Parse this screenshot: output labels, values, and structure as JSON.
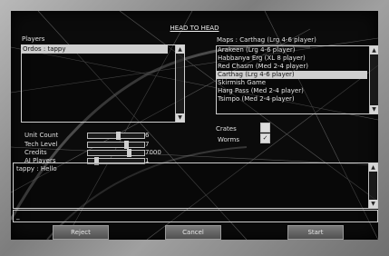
{
  "title": "HEAD TO HEAD",
  "players": {
    "label": "Players",
    "items": [
      "Ordos : tappy"
    ]
  },
  "maps": {
    "label": "Maps : Carthag (Lrg 4-6 player)",
    "items": [
      "Arakeen (Lrg 4-6 player)",
      "Habbanya Erg (XL 8 player)",
      "Red Chasm (Med 2-4 player)",
      "Carthag (Lrg 4-6 player)",
      "Skirmish Game",
      "Harg Pass (Med 2-4 player)",
      "Tsimpo (Med 2-4 player)"
    ],
    "selected_index": 3
  },
  "settings": [
    {
      "label": "Unit Count",
      "value": "6",
      "level": 0.55
    },
    {
      "label": "Tech Level",
      "value": "7",
      "level": 0.7
    },
    {
      "label": "Credits",
      "value": "7000",
      "level": 0.75
    },
    {
      "label": "AI Players",
      "value": "1",
      "level": 0.12
    }
  ],
  "toggles": {
    "crates_label": "Crates",
    "worms_label": "Worms",
    "crates_checked": false,
    "worms_checked": true
  },
  "chat": {
    "messages": [
      "tappy : Hello"
    ],
    "input_value": "_"
  },
  "buttons": {
    "reject": "Reject",
    "cancel": "Cancel",
    "start": "Start"
  },
  "colors": {
    "accent": "#cfcfcf",
    "background": "#0b0b0b"
  }
}
